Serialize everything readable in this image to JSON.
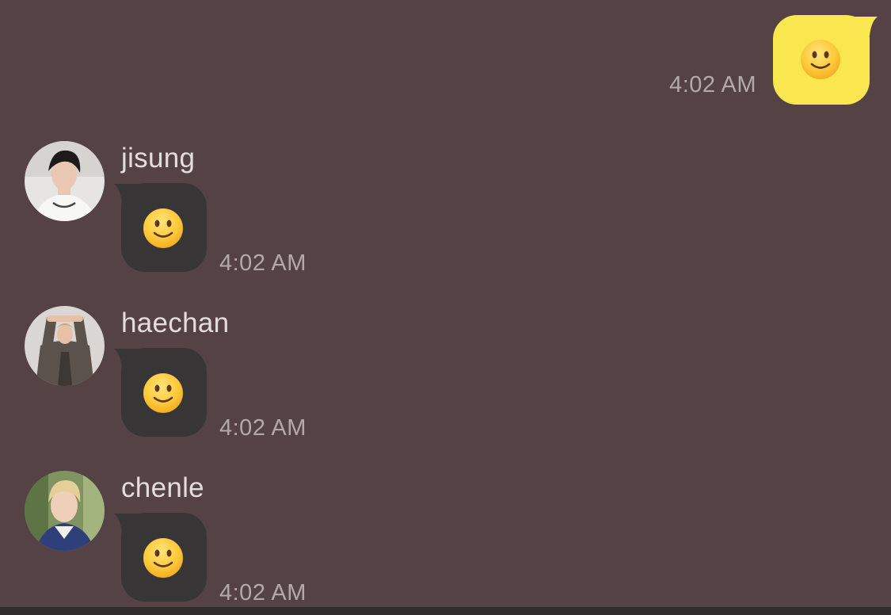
{
  "colors": {
    "background": "#554244",
    "outgoing_bubble": "#fae74f",
    "incoming_bubble": "#383536",
    "timestamp": "#b3a9aa",
    "sender_name": "#e4dcdd"
  },
  "outgoing": {
    "time": "4:02 AM",
    "content_icon": "slightly-smiling-face-emoji"
  },
  "messages": [
    {
      "sender": "jisung",
      "time": "4:02 AM",
      "content_icon": "slightly-smiling-face-emoji",
      "avatar_icon": "profile-photo"
    },
    {
      "sender": "haechan",
      "time": "4:02 AM",
      "content_icon": "slightly-smiling-face-emoji",
      "avatar_icon": "profile-photo"
    },
    {
      "sender": "chenle",
      "time": "4:02 AM",
      "content_icon": "slightly-smiling-face-emoji",
      "avatar_icon": "profile-photo"
    }
  ]
}
